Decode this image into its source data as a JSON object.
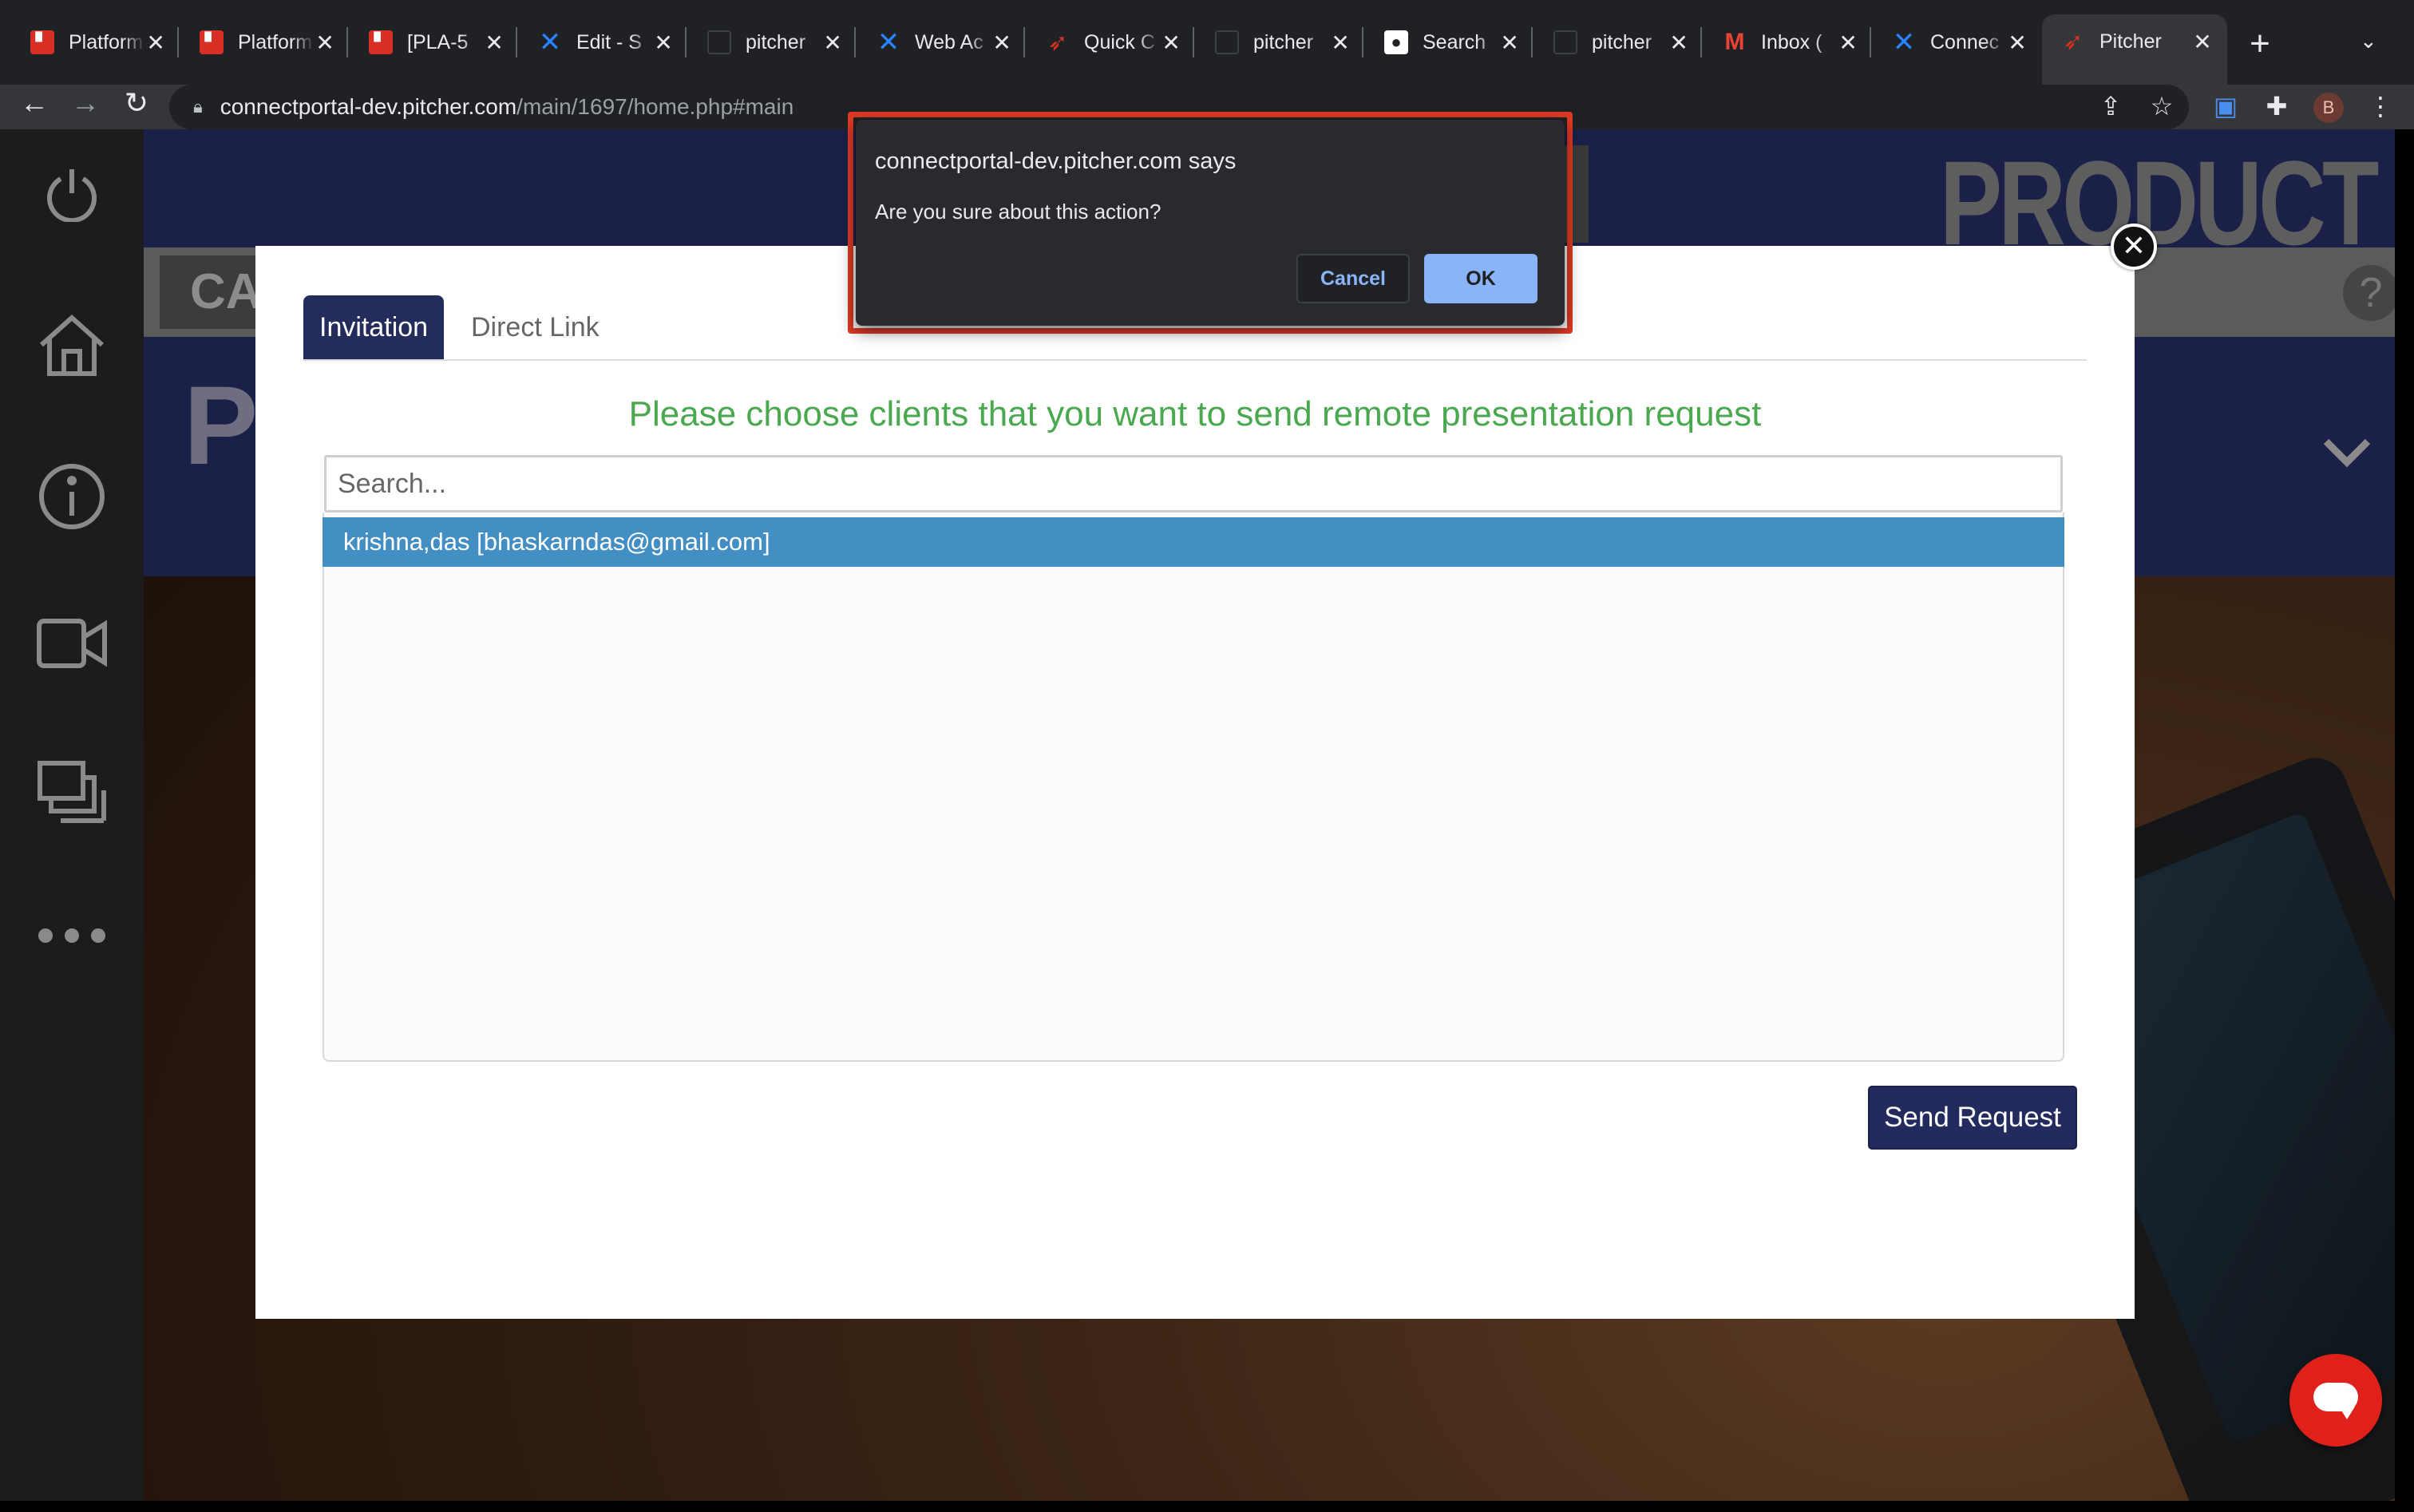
{
  "browser": {
    "tabs": [
      {
        "title": "Platform",
        "favicon": "red-square-icon"
      },
      {
        "title": "Platform",
        "favicon": "red-square-icon"
      },
      {
        "title": "[PLA-5",
        "favicon": "red-square-icon"
      },
      {
        "title": "Edit - S",
        "favicon": "confluence-icon"
      },
      {
        "title": "pitcher",
        "favicon": "github-dark-icon"
      },
      {
        "title": "Web Ac",
        "favicon": "confluence-icon"
      },
      {
        "title": "Quick C",
        "favicon": "pitcher-icon"
      },
      {
        "title": "pitcher",
        "favicon": "github-dark-icon"
      },
      {
        "title": "Search",
        "favicon": "github-icon"
      },
      {
        "title": "pitcher",
        "favicon": "github-dark-icon"
      },
      {
        "title": "Inbox (",
        "favicon": "gmail-icon"
      },
      {
        "title": "Connec",
        "favicon": "confluence-icon"
      },
      {
        "title": "Pitcher",
        "favicon": "pitcher-icon",
        "active": true
      }
    ],
    "url_host": "connectportal-dev.pitcher.com",
    "url_path": "/main/1697/home.php#main",
    "profile_initial": "B"
  },
  "background": {
    "title": "PRODUCT I...",
    "category_fragment": "CATE",
    "heading_fragment": "PR",
    "help": "?"
  },
  "modal": {
    "tabs": [
      "Invitation",
      "Direct Link"
    ],
    "active_tab": "Invitation",
    "heading": "Please choose clients that you want to send remote presentation request",
    "search_placeholder": "Search...",
    "clients": [
      "krishna,das [bhaskarndas@gmail.com]"
    ],
    "send_label": "Send Request"
  },
  "alert": {
    "title": "connectportal-dev.pitcher.com says",
    "message": "Are you sure about this action?",
    "cancel_label": "Cancel",
    "ok_label": "OK"
  },
  "colors": {
    "accent_navy": "#232a5e",
    "heading_green": "#4aa84f",
    "selected_row": "#438fc4",
    "alert_highlight": "#e03a25",
    "chat_red": "#e0211b"
  }
}
